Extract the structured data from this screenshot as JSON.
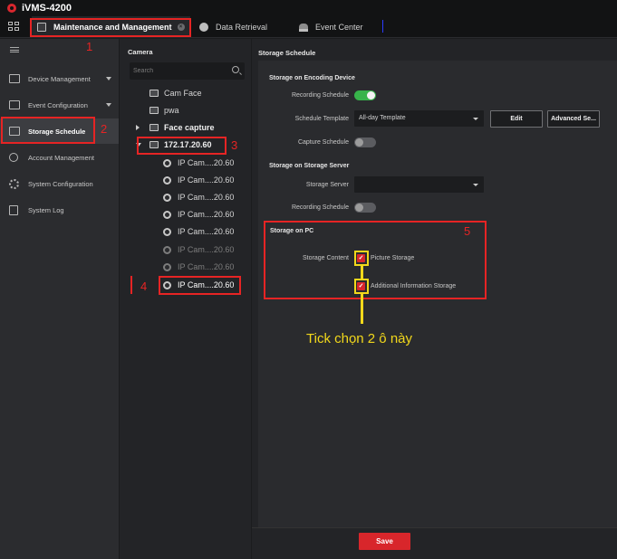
{
  "app": {
    "title": "iVMS-4200"
  },
  "tabs": [
    {
      "label": "Maintenance and Management",
      "active": true
    },
    {
      "label": "Data Retrieval"
    },
    {
      "label": "Event Center"
    }
  ],
  "sidebar": {
    "items": [
      {
        "label": "Device Management",
        "icon": "device-icon",
        "has_caret": true
      },
      {
        "label": "Event Configuration",
        "icon": "event-config-icon",
        "has_caret": true
      },
      {
        "label": "Storage Schedule",
        "icon": "storage-icon",
        "active": true
      },
      {
        "label": "Account Management",
        "icon": "user-icon"
      },
      {
        "label": "System Configuration",
        "icon": "gear-icon"
      },
      {
        "label": "System Log",
        "icon": "log-icon"
      }
    ]
  },
  "camera_panel": {
    "title": "Camera",
    "search_placeholder": "Search",
    "tree": [
      {
        "label": "Cam Face",
        "type": "group"
      },
      {
        "label": "pwa",
        "type": "group"
      },
      {
        "label": "Face capture",
        "type": "group",
        "collapsed": true
      },
      {
        "label": "172.17.20.60",
        "type": "group",
        "expanded": true
      },
      {
        "label": "IP Cam....20.60",
        "type": "camera"
      },
      {
        "label": "IP Cam....20.60",
        "type": "camera"
      },
      {
        "label": "IP Cam....20.60",
        "type": "camera"
      },
      {
        "label": "IP Cam....20.60",
        "type": "camera"
      },
      {
        "label": "IP Cam....20.60",
        "type": "camera"
      },
      {
        "label": "IP Cam....20.60",
        "type": "camera",
        "offline": true
      },
      {
        "label": "IP Cam....20.60",
        "type": "camera",
        "offline": true
      },
      {
        "label": "IP Cam....20.60",
        "type": "camera",
        "selected": true
      }
    ]
  },
  "storage_schedule": {
    "title": "Storage Schedule",
    "encoding_device": {
      "title": "Storage on Encoding Device",
      "recording_schedule_label": "Recording Schedule",
      "recording_schedule_on": true,
      "schedule_template_label": "Schedule Template",
      "schedule_template_value": "All-day Template",
      "edit_label": "Edit",
      "advanced_label": "Advanced Se...",
      "capture_schedule_label": "Capture Schedule",
      "capture_schedule_on": false
    },
    "storage_server": {
      "title": "Storage on Storage Server",
      "storage_server_label": "Storage Server",
      "storage_server_value": "",
      "recording_schedule_label": "Recording Schedule",
      "recording_schedule_on": false
    },
    "pc": {
      "title": "Storage on PC",
      "storage_content_label": "Storage Content",
      "picture_storage_label": "Picture Storage",
      "picture_storage_checked": true,
      "additional_info_label": "Additional Information Storage",
      "additional_info_checked": true
    },
    "save_label": "Save"
  },
  "annotations": {
    "numbers": [
      "1",
      "2",
      "3",
      "4",
      "5"
    ],
    "note": "Tick chọn 2 ô này"
  },
  "colors": {
    "accent_red": "#d8262b",
    "toggle_on": "#37b34a",
    "annotation_red": "#e62424",
    "annotation_yellow": "#f2d81b"
  }
}
